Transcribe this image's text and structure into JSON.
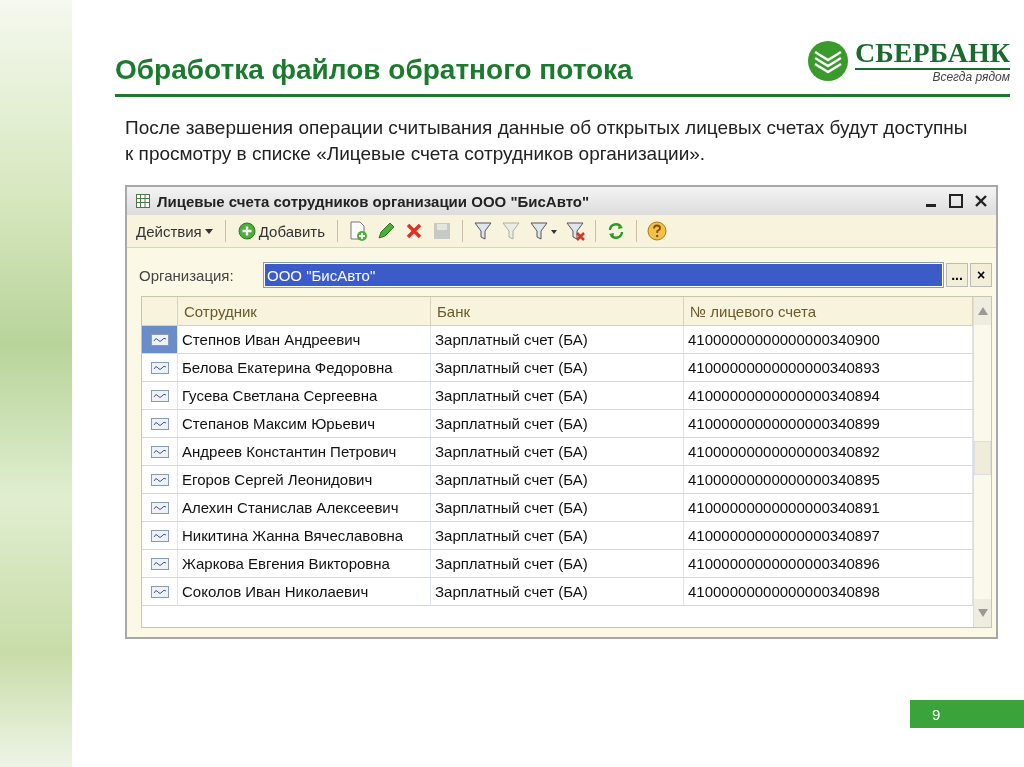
{
  "slide": {
    "title": "Обработка файлов обратного потока",
    "logo": {
      "name": "СБЕРБАНК",
      "tagline": "Всегда рядом"
    },
    "paragraph": "После завершения операции считывания данные об открытых лицевых счетах будут доступны к просмотру в списке «Лицевые счета сотрудников организации».",
    "page_number": "9"
  },
  "window": {
    "title": "Лицевые счета сотрудников организации ООО \"БисАвто\""
  },
  "toolbar": {
    "actions_label": "Действия",
    "add_label": "Добавить",
    "tools": [
      {
        "kind": "copy",
        "disabled": false
      },
      {
        "kind": "edit",
        "disabled": false
      },
      {
        "kind": "delete",
        "disabled": false
      },
      {
        "kind": "save",
        "disabled": true
      },
      {
        "kind": "filter",
        "disabled": false
      },
      {
        "kind": "filter",
        "disabled": true
      },
      {
        "kind": "filter-menu",
        "disabled": false
      },
      {
        "kind": "filter-clear",
        "disabled": false
      },
      {
        "kind": "refresh",
        "disabled": false
      },
      {
        "kind": "help",
        "disabled": false
      }
    ]
  },
  "organization": {
    "label": "Организация:",
    "value": "ООО \"БисАвто\"",
    "select_label": "...",
    "clear_label": "×"
  },
  "table": {
    "columns": [
      "Сотрудник",
      "Банк",
      "№ лицевого счета"
    ],
    "rows": [
      {
        "employee": "Степнов Иван Андреевич",
        "bank": "Зарплатный счет (БА)",
        "account": "41000000000000000340900",
        "selected": true
      },
      {
        "employee": "Белова Екатерина Федоровна",
        "bank": "Зарплатный счет (БА)",
        "account": "41000000000000000340893",
        "selected": false
      },
      {
        "employee": "Гусева Светлана Сергеевна",
        "bank": "Зарплатный счет (БА)",
        "account": "41000000000000000340894",
        "selected": false
      },
      {
        "employee": "Степанов Максим Юрьевич",
        "bank": "Зарплатный счет (БА)",
        "account": "41000000000000000340899",
        "selected": false
      },
      {
        "employee": "Андреев Константин Петрович",
        "bank": "Зарплатный счет (БА)",
        "account": "41000000000000000340892",
        "selected": false
      },
      {
        "employee": "Егоров Сергей Леонидович",
        "bank": "Зарплатный счет (БА)",
        "account": "41000000000000000340895",
        "selected": false
      },
      {
        "employee": "Алехин Станислав Алексеевич",
        "bank": "Зарплатный счет (БА)",
        "account": "41000000000000000340891",
        "selected": false
      },
      {
        "employee": "Никитина Жанна Вячеславовна",
        "bank": "Зарплатный счет (БА)",
        "account": "41000000000000000340897",
        "selected": false
      },
      {
        "employee": "Жаркова Евгения Викторовна",
        "bank": "Зарплатный счет (БА)",
        "account": "41000000000000000340896",
        "selected": false
      },
      {
        "employee": "Соколов Иван Николаевич",
        "bank": "Зарплатный счет (БА)",
        "account": "41000000000000000340898",
        "selected": false
      }
    ]
  }
}
